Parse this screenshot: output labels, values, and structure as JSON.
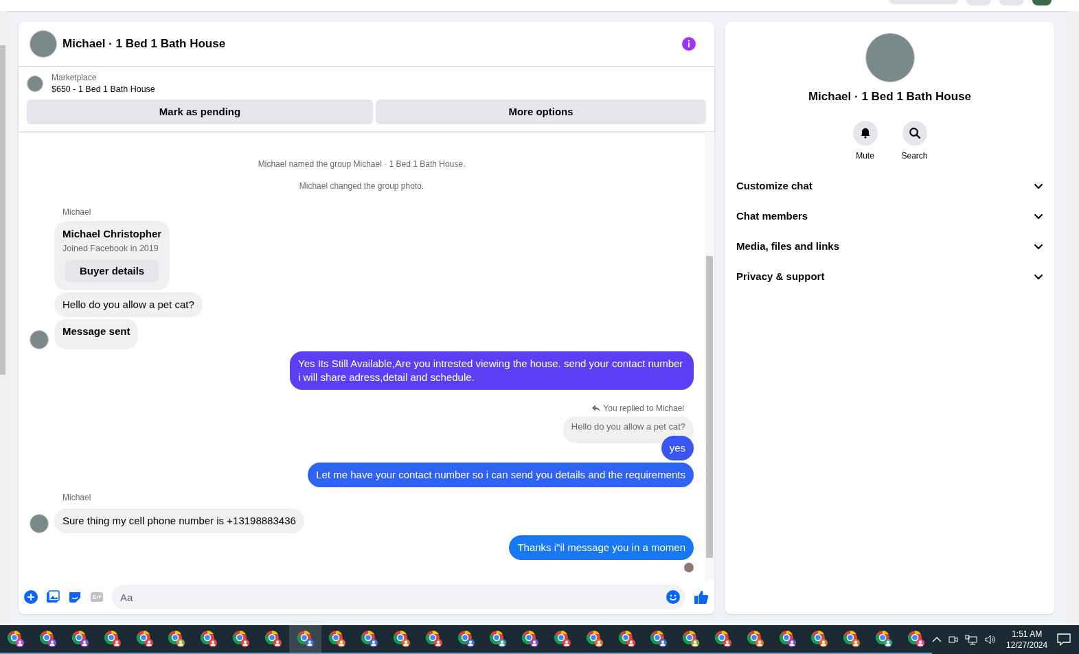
{
  "chat": {
    "title": "Michael · 1 Bed 1 Bath House",
    "listing": {
      "source": "Marketplace",
      "summary": "$650 - 1 Bed 1 Bath House"
    },
    "actions": [
      "Mark as pending",
      "More options"
    ],
    "messages": [
      {
        "kind": "system",
        "text": "Michael named the group Michael · 1 Bed 1 Bath House."
      },
      {
        "kind": "system",
        "text": "Michael changed the group photo."
      },
      {
        "kind": "sender",
        "text": "Michael"
      },
      {
        "kind": "profile",
        "name": "Michael Christopher",
        "detail": "Joined Facebook in 2019",
        "button": "Buyer details"
      },
      {
        "kind": "incoming",
        "text": "Hello do you allow a pet cat?",
        "avatar": false,
        "bold": false
      },
      {
        "kind": "incoming",
        "text": "Message sent",
        "avatar": true,
        "bold": true
      },
      {
        "kind": "outgoing",
        "text": "Yes Its Still Available,Are you intrested viewing the house. send your contact number i will share adress,detail and schedule.",
        "color": "#5b3ff5"
      },
      {
        "kind": "reply",
        "label": "You replied to Michael",
        "quote": "Hello do you allow a pet cat?"
      },
      {
        "kind": "outgoing",
        "text": "yes",
        "color": "#3a55f5"
      },
      {
        "kind": "outgoing",
        "text": "Let me have your contact number so i can send you details and the requirements",
        "color": "#2f63f5"
      },
      {
        "kind": "sender",
        "text": "Michael"
      },
      {
        "kind": "incoming",
        "text": "Sure thing my cell phone number is +13198883436",
        "avatar": true,
        "bold": false
      },
      {
        "kind": "outgoing",
        "text": "Thanks i\"il message you in a momen",
        "color": "#1877f2"
      },
      {
        "kind": "seen"
      }
    ],
    "composer": {
      "placeholder": "Aa"
    }
  },
  "details": {
    "title": "Michael · 1 Bed 1 Bath House",
    "buttons": [
      {
        "kind": "bell",
        "label": "Mute"
      },
      {
        "kind": "search",
        "label": "Search"
      }
    ],
    "sections": [
      {
        "label": "Customize chat",
        "expanded": false
      },
      {
        "label": "Chat members",
        "expanded": false
      },
      {
        "label": "Media, files and links",
        "expanded": false
      },
      {
        "label": "Privacy & support",
        "expanded": false
      }
    ]
  },
  "taskbar": {
    "apps": [
      {
        "color": "#c04fd0",
        "selected": false
      },
      {
        "color": "#8a4fd0",
        "selected": false
      },
      {
        "color": "#8a4fd0",
        "selected": false
      },
      {
        "color": "#e04848",
        "selected": false
      },
      {
        "color": "#e04848",
        "selected": false
      },
      {
        "color": "#a0a040",
        "selected": false
      },
      {
        "color": "#e04848",
        "selected": false
      },
      {
        "color": "#e04848",
        "selected": false
      },
      {
        "color": "#e04848",
        "selected": false
      },
      {
        "color": "#3f6fd0",
        "selected": true
      },
      {
        "color": "#e07030",
        "selected": false
      },
      {
        "color": "#3f6fd0",
        "selected": false
      },
      {
        "color": "#e07030",
        "selected": false
      },
      {
        "color": "#e04848",
        "selected": false
      },
      {
        "color": "#3f6fd0",
        "selected": false
      },
      {
        "color": "#3aa0a0",
        "selected": false
      },
      {
        "color": "#8a4fd0",
        "selected": false
      },
      {
        "color": "#e04848",
        "selected": false
      },
      {
        "color": "#e07030",
        "selected": false
      },
      {
        "color": "#e04848",
        "selected": false
      },
      {
        "color": "#3f6fd0",
        "selected": false
      },
      {
        "color": "#a0a040",
        "selected": false
      },
      {
        "color": "#e04848",
        "selected": false
      },
      {
        "color": "#e07030",
        "selected": false
      },
      {
        "color": "#8a4fd0",
        "selected": false
      },
      {
        "color": "#e07030",
        "selected": false
      },
      {
        "color": "#e07030",
        "selected": false
      },
      {
        "color": "#3aa0a0",
        "selected": false
      },
      {
        "color": "#e04890",
        "selected": false
      }
    ],
    "time": "1:51 AM",
    "date": "12/27/2024"
  }
}
